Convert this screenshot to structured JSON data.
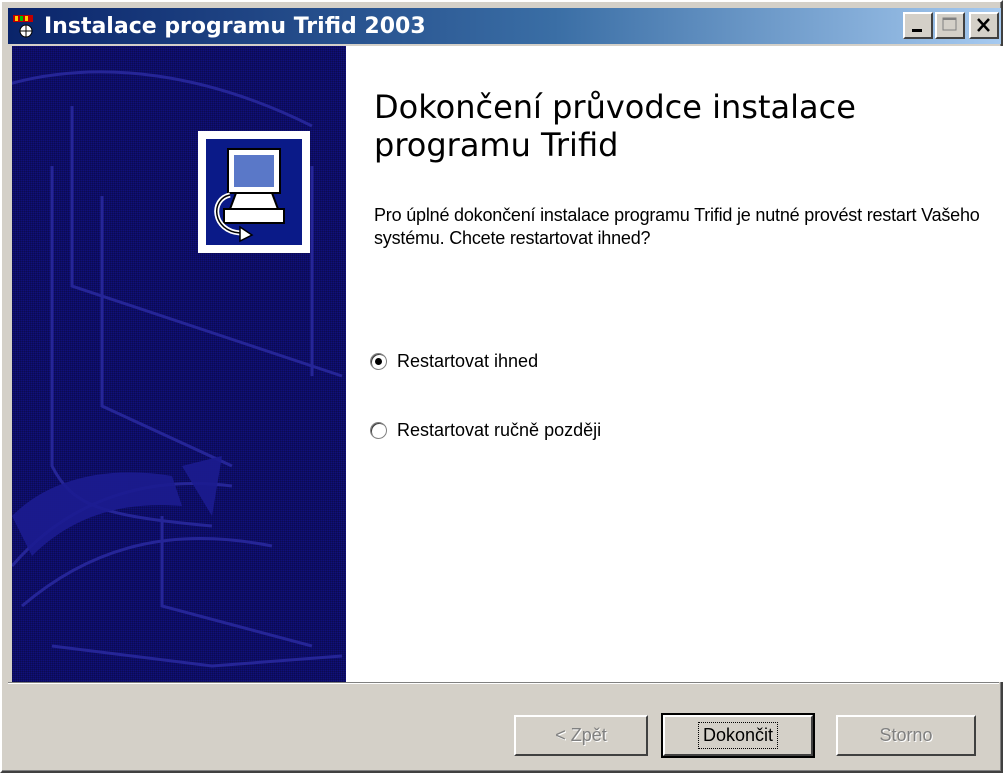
{
  "window": {
    "title": "Instalace programu Trifid 2003",
    "icon": "installer-app-icon",
    "controls": [
      "minimize-icon",
      "maximize-icon",
      "close-icon"
    ]
  },
  "banner": {
    "color": "#10107a",
    "logo_icon": "computer-setup-icon"
  },
  "content": {
    "heading": "Dokončení průvodce instalace programu Trifid",
    "description": "Pro úplné dokončení instalace programu Trifid je nutné provést restart Vašeho systému. Chcete restartovat ihned?",
    "options": [
      {
        "label": "Restartovat ihned",
        "selected": true
      },
      {
        "label": "Restartovat ručně později",
        "selected": false
      }
    ]
  },
  "buttons": {
    "back": {
      "label": "< Zpět",
      "enabled": false
    },
    "finish": {
      "label": "Dokončit",
      "enabled": true,
      "default": true
    },
    "cancel": {
      "label": "Storno",
      "enabled": false
    }
  },
  "colors": {
    "titlebar_start": "#0a246a",
    "titlebar_end": "#a6caf0",
    "dialog_face": "#d4d0c8"
  }
}
